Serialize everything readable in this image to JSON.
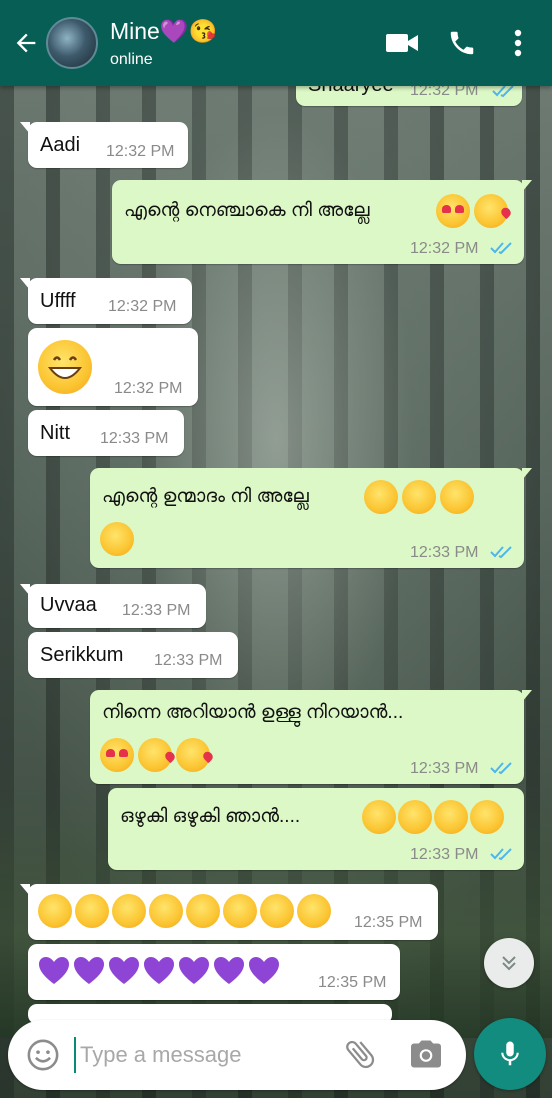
{
  "header": {
    "contact_name": "Mine💜😘",
    "status": "online",
    "colors": {
      "bar": "#075e54",
      "accent": "#128c7e"
    }
  },
  "messages": [
    {
      "direction": "out",
      "text": "Shaaryee",
      "time": "12:32 PM",
      "ticks": "read"
    },
    {
      "direction": "in",
      "text": "Aadi",
      "time": "12:32 PM"
    },
    {
      "direction": "out",
      "text": "എന്റെ നെഞ്ചാകെ നി  അല്ലേ",
      "emojis": [
        "heart-eyes",
        "kiss-wink"
      ],
      "time": "12:32 PM",
      "ticks": "read"
    },
    {
      "direction": "in",
      "text": "Uffff",
      "time": "12:32 PM"
    },
    {
      "direction": "in",
      "emojis": [
        "grin"
      ],
      "time": "12:32 PM"
    },
    {
      "direction": "in",
      "text": "Nitt",
      "time": "12:33 PM"
    },
    {
      "direction": "out",
      "text": "എന്റെ ഉന്മാദം നി  അല്ലേ",
      "emojis": [
        "yum",
        "yum",
        "kiss-closed",
        "smirk"
      ],
      "time": "12:33 PM",
      "ticks": "read"
    },
    {
      "direction": "in",
      "text": "Uvvaa",
      "time": "12:33 PM"
    },
    {
      "direction": "in",
      "text": "Serikkum",
      "time": "12:33 PM"
    },
    {
      "direction": "out",
      "text": "നിന്നെ അറിയാൻ ഉള്ളു നിറയാൻ...",
      "emojis": [
        "hearts",
        "kiss-wink",
        "kiss-wink"
      ],
      "time": "12:33 PM",
      "ticks": "read"
    },
    {
      "direction": "out",
      "text": "ഒഴുകി ഒഴുകി ഞാൻ....",
      "emojis": [
        "halo",
        "halo",
        "yum",
        "yum"
      ],
      "time": "12:33 PM",
      "ticks": "read"
    },
    {
      "direction": "in",
      "emojis": [
        "kiss-closed",
        "kiss-closed",
        "kiss-closed",
        "kiss-closed",
        "kiss-closed",
        "kiss-closed",
        "kiss-closed",
        "kiss-closed"
      ],
      "time": "12:35 PM"
    },
    {
      "direction": "in",
      "emojis": [
        "purple-heart",
        "purple-heart",
        "purple-heart",
        "purple-heart",
        "purple-heart",
        "purple-heart",
        "purple-heart"
      ],
      "time": "12:35 PM"
    }
  ],
  "composer": {
    "placeholder": "Type a message"
  },
  "icons": [
    "back-arrow-icon",
    "video-call-icon",
    "phone-icon",
    "more-vert-icon",
    "scroll-down-icon",
    "emoji-icon",
    "attach-icon",
    "camera-icon",
    "mic-icon"
  ]
}
